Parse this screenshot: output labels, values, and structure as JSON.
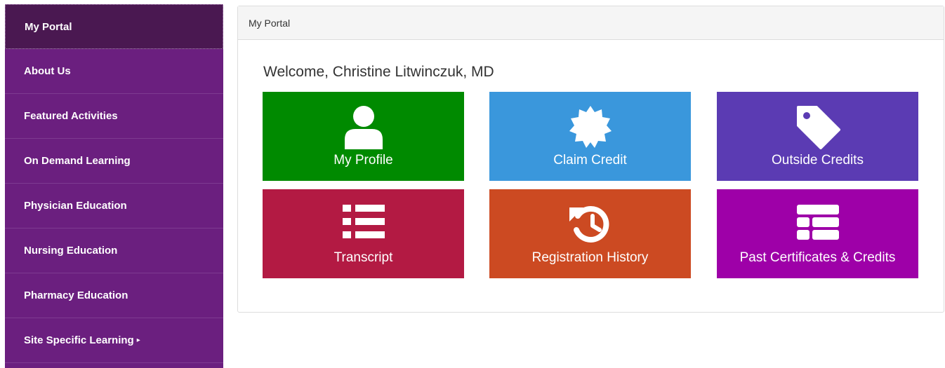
{
  "sidebar": {
    "items": [
      {
        "label": "My Portal",
        "active": true
      },
      {
        "label": "About Us"
      },
      {
        "label": "Featured Activities"
      },
      {
        "label": "On Demand Learning"
      },
      {
        "label": "Physician Education"
      },
      {
        "label": "Nursing Education"
      },
      {
        "label": "Pharmacy Education"
      },
      {
        "label": "Site Specific Learning",
        "caret": "▸"
      }
    ]
  },
  "panel": {
    "heading": "My Portal",
    "welcome": "Welcome, Christine Litwinczuk, MD"
  },
  "tiles": [
    {
      "label": "My Profile",
      "icon": "user-icon",
      "color": "#008a00"
    },
    {
      "label": "Claim Credit",
      "icon": "certificate-icon",
      "color": "#3a97dc"
    },
    {
      "label": "Outside Credits",
      "icon": "tag-icon",
      "color": "#5b3bb3"
    },
    {
      "label": "Transcript",
      "icon": "list-icon",
      "color": "#b31a43"
    },
    {
      "label": "Registration History",
      "icon": "history-icon",
      "color": "#cc4a22"
    },
    {
      "label": "Past Certificates & Credits",
      "icon": "table-icon",
      "color": "#9e00a8"
    }
  ]
}
